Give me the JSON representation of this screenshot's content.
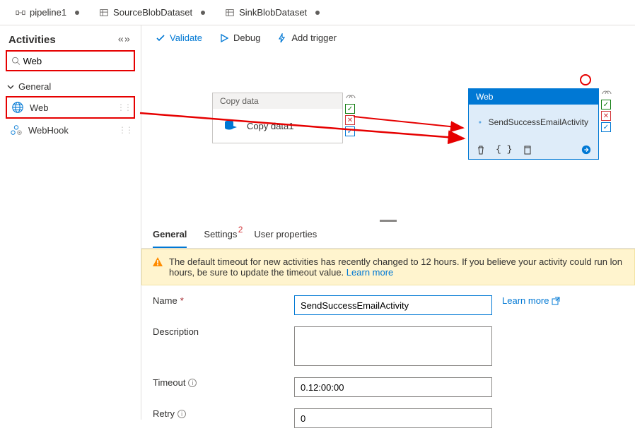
{
  "tabs": [
    {
      "label": "pipeline1",
      "icon": "pipeline"
    },
    {
      "label": "SourceBlobDataset",
      "icon": "dataset"
    },
    {
      "label": "SinkBlobDataset",
      "icon": "dataset"
    }
  ],
  "sidebar": {
    "title": "Activities",
    "search_value": "Web",
    "group": "General",
    "items": [
      {
        "label": "Web",
        "highlight": true
      },
      {
        "label": "WebHook",
        "highlight": false
      }
    ]
  },
  "toolbar": {
    "validate": "Validate",
    "debug": "Debug",
    "add_trigger": "Add trigger"
  },
  "canvas": {
    "copy_header": "Copy data",
    "copy_label": "Copy data1",
    "web_header": "Web",
    "web_label": "SendSuccessEmailActivity"
  },
  "prop_tabs": {
    "general": "General",
    "settings": "Settings",
    "user_props": "User properties",
    "settings_badge": "2"
  },
  "warning": {
    "text_a": "The default timeout for new activities has recently changed to 12 hours. If you believe your activity could run lon",
    "text_b": "hours, be sure to update the timeout value.",
    "learn": "Learn more"
  },
  "form": {
    "name_label": "Name",
    "name_value": "SendSuccessEmailActivity",
    "learn_more": "Learn more",
    "desc_label": "Description",
    "desc_value": "",
    "timeout_label": "Timeout",
    "timeout_value": "0.12:00:00",
    "retry_label": "Retry",
    "retry_value": "0"
  }
}
